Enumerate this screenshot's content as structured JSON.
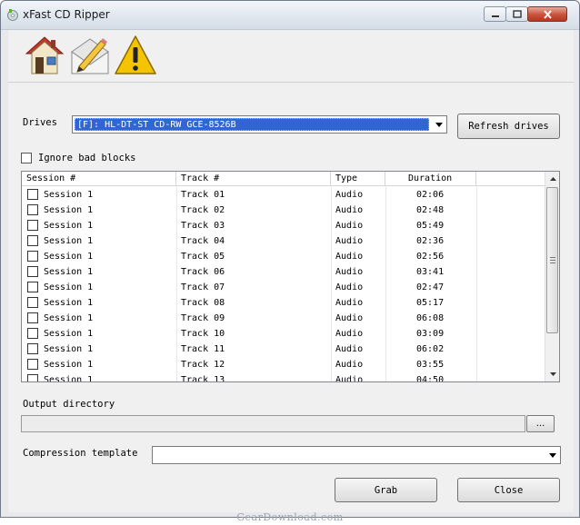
{
  "window": {
    "title": "xFast CD Ripper"
  },
  "toolbar": {
    "items": [
      {
        "name": "home",
        "icon": "home-icon"
      },
      {
        "name": "edit",
        "icon": "edit-icon"
      },
      {
        "name": "warning",
        "icon": "warning-icon"
      }
    ]
  },
  "drives": {
    "label": "Drives",
    "selected": "[F]: HL-DT-ST CD-RW GCE-8526B",
    "refresh_label": "Refresh drives"
  },
  "options": {
    "ignore_bad_blocks_label": "Ignore bad blocks",
    "ignore_bad_blocks_checked": false
  },
  "tracklist": {
    "columns": [
      "Session #",
      "Track #",
      "Type",
      "Duration"
    ],
    "rows": [
      {
        "session": "Session 1",
        "track": "Track 01",
        "type": "Audio",
        "duration": "02:06",
        "checked": false
      },
      {
        "session": "Session 1",
        "track": "Track 02",
        "type": "Audio",
        "duration": "02:48",
        "checked": false
      },
      {
        "session": "Session 1",
        "track": "Track 03",
        "type": "Audio",
        "duration": "05:49",
        "checked": false
      },
      {
        "session": "Session 1",
        "track": "Track 04",
        "type": "Audio",
        "duration": "02:36",
        "checked": false
      },
      {
        "session": "Session 1",
        "track": "Track 05",
        "type": "Audio",
        "duration": "02:56",
        "checked": false
      },
      {
        "session": "Session 1",
        "track": "Track 06",
        "type": "Audio",
        "duration": "03:41",
        "checked": false
      },
      {
        "session": "Session 1",
        "track": "Track 07",
        "type": "Audio",
        "duration": "02:47",
        "checked": false
      },
      {
        "session": "Session 1",
        "track": "Track 08",
        "type": "Audio",
        "duration": "05:17",
        "checked": false
      },
      {
        "session": "Session 1",
        "track": "Track 09",
        "type": "Audio",
        "duration": "06:08",
        "checked": false
      },
      {
        "session": "Session 1",
        "track": "Track 10",
        "type": "Audio",
        "duration": "03:09",
        "checked": false
      },
      {
        "session": "Session 1",
        "track": "Track 11",
        "type": "Audio",
        "duration": "06:02",
        "checked": false
      },
      {
        "session": "Session 1",
        "track": "Track 12",
        "type": "Audio",
        "duration": "03:55",
        "checked": false
      },
      {
        "session": "Session 1",
        "track": "Track 13",
        "type": "Audio",
        "duration": "04:50",
        "checked": false
      }
    ]
  },
  "output": {
    "label": "Output directory",
    "value": "",
    "browse_label": "..."
  },
  "compression": {
    "label": "Compression template",
    "selected": ""
  },
  "actions": {
    "grab_label": "Grab",
    "close_label": "Close"
  },
  "watermark": "GearDownload.com",
  "colors": {
    "selection": "#3165d1",
    "window_bg": "#f0f0f0"
  }
}
